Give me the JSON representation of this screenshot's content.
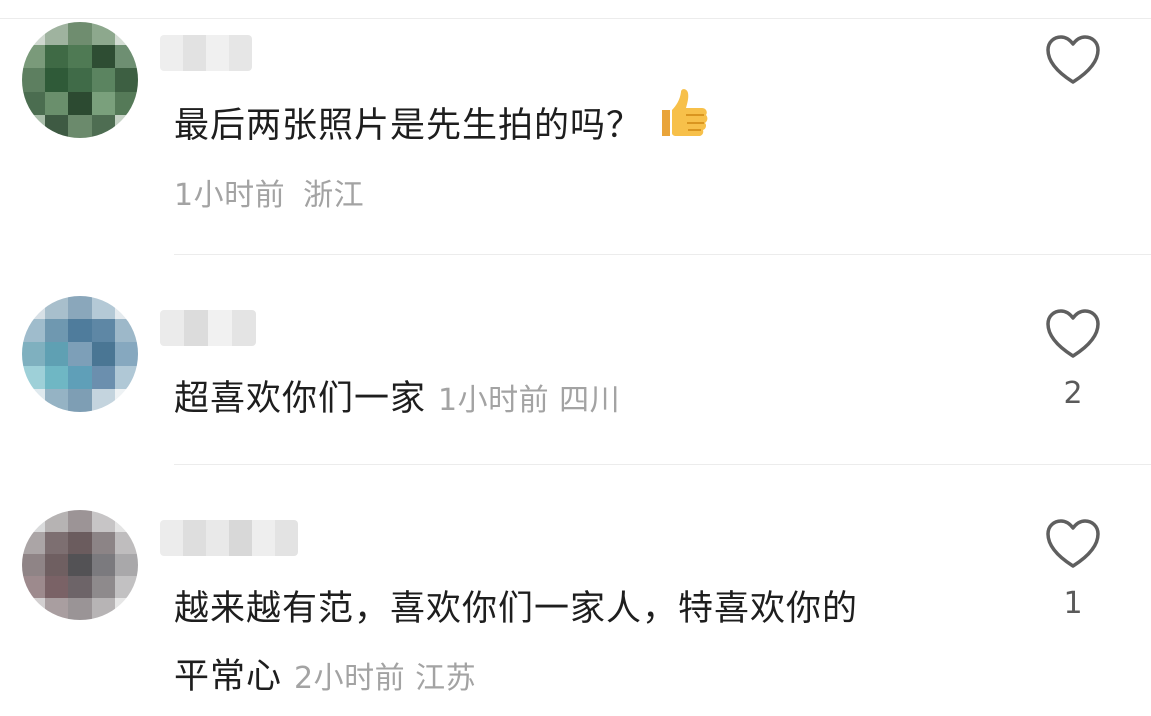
{
  "comments": [
    {
      "text": "最后两张照片是先生拍的吗？",
      "emoji": "thumbs-up-emoji",
      "time": "1小时前",
      "location": "浙江",
      "likes": ""
    },
    {
      "text": "超喜欢你们一家",
      "time": "1小时前",
      "location": "四川",
      "likes": "2"
    },
    {
      "text_line1": "越来越有范，喜欢你们一家人，特喜欢你的",
      "text_line2": "平常心",
      "time": "2小时前",
      "location": "江苏",
      "likes": "1"
    }
  ],
  "icons": {
    "like": "heart-outline-icon"
  },
  "colors": {
    "text": "#1e1e1e",
    "meta": "#a3a3a3",
    "divider": "#ececec",
    "heart": "#5f5f5f"
  }
}
